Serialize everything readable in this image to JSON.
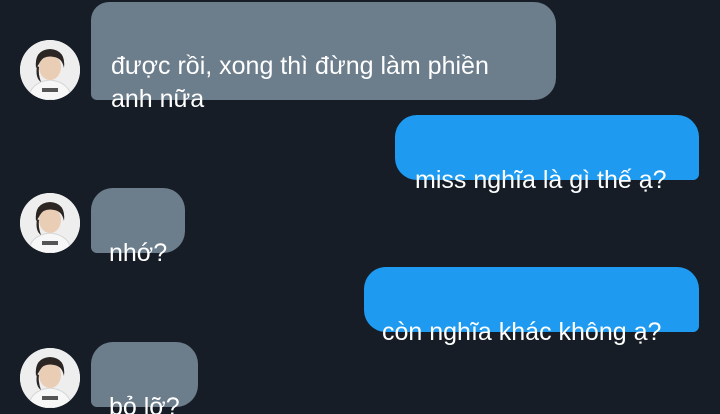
{
  "messages": [
    {
      "direction": "incoming",
      "text": "được rồi, xong thì đừng làm phiền\nanh nữa"
    },
    {
      "direction": "outgoing",
      "text": "miss nghĩa là gì thế ạ?"
    },
    {
      "direction": "incoming",
      "text": "nhớ?"
    },
    {
      "direction": "outgoing",
      "text": "còn nghĩa khác không ạ?"
    },
    {
      "direction": "incoming",
      "text": "bỏ lỡ?"
    }
  ],
  "colors": {
    "background": "#161d26",
    "incoming_bubble": "#6c7d8c",
    "outgoing_bubble": "#1e9bf0",
    "text": "#ffffff"
  },
  "icons": {
    "avatar": "contact-avatar-photo"
  }
}
